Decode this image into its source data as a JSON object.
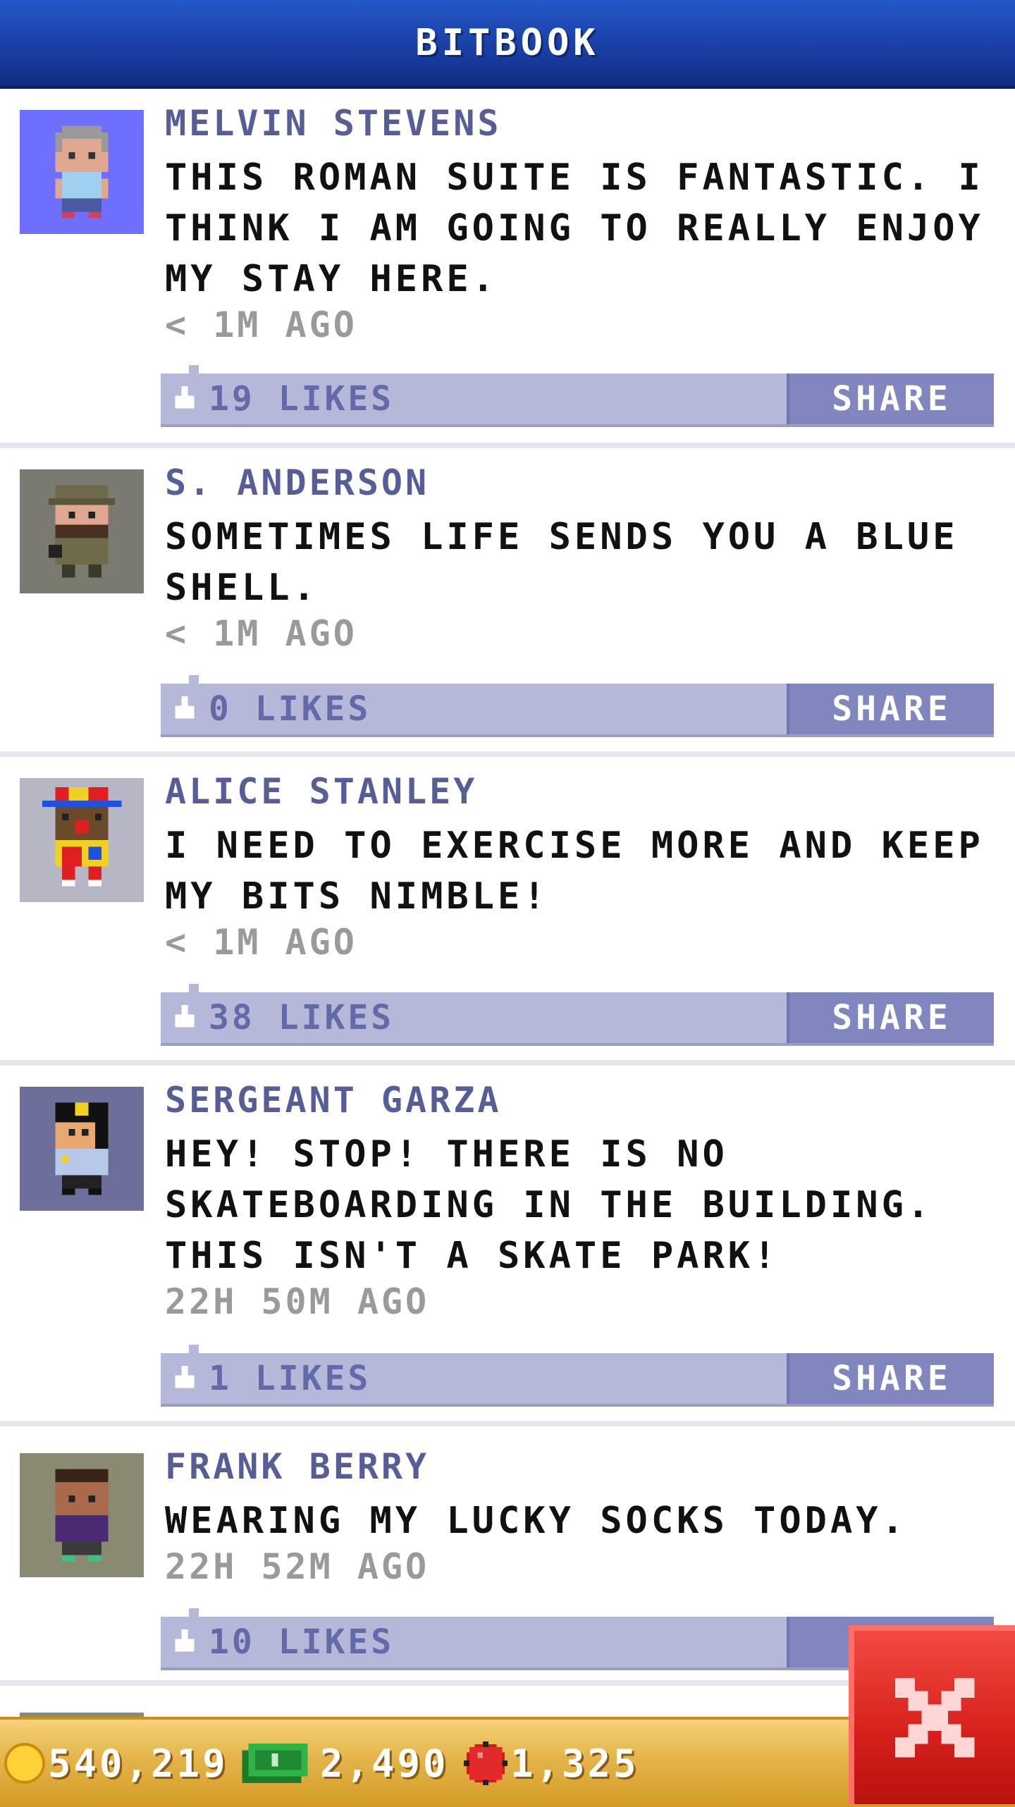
{
  "header": {
    "title": "BITBOOK"
  },
  "posts": [
    {
      "author": "MELVIN STEVENS",
      "message": "THIS ROMAN SUITE IS FANTASTIC. I THINK I AM GOING TO REALLY ENJOY MY STAY HERE.",
      "time": "< 1M AGO",
      "likes": "19 LIKES",
      "share": "SHARE",
      "avatar_bg": "#6f6fff",
      "avatar_icon": "elder-avatar-icon"
    },
    {
      "author": "S. ANDERSON",
      "message": "SOMETIMES LIFE SENDS YOU A BLUE SHELL.",
      "time": "< 1M AGO",
      "likes": "0 LIKES",
      "share": "SHARE",
      "avatar_bg": "#7a7a70",
      "avatar_icon": "soldier-avatar-icon"
    },
    {
      "author": "ALICE STANLEY",
      "message": "I NEED TO EXERCISE MORE AND KEEP MY BITS NIMBLE!",
      "time": "< 1M AGO",
      "likes": "38 LIKES",
      "share": "SHARE",
      "avatar_bg": "#b6b6c4",
      "avatar_icon": "clown-avatar-icon"
    },
    {
      "author": "SERGEANT GARZA",
      "message": "HEY! STOP! THERE IS NO SKATEBOARDING IN THE BUILDING. THIS ISN'T A SKATE PARK!",
      "time": "22H 50M AGO",
      "likes": "1 LIKES",
      "share": "SHARE",
      "avatar_bg": "#6b6f9a",
      "avatar_icon": "police-avatar-icon"
    },
    {
      "author": "FRANK BERRY",
      "message": "WEARING MY LUCKY SOCKS TODAY.",
      "time": "22H 52M AGO",
      "likes": "10 LIKES",
      "share": "SH",
      "avatar_bg": "#8a8a72",
      "avatar_icon": "man-avatar-icon"
    }
  ],
  "resources": {
    "coins": "540,219",
    "bux": "2,490",
    "gems": "1,325"
  },
  "colors": {
    "header": "#17399c",
    "accent": "#575e97",
    "like_bar": "#b6b8da",
    "share": "#8186be",
    "bottom_bar": "#e3b44a",
    "close": "#d61f1b"
  },
  "icons": {
    "coin": "coin-icon",
    "bux": "bux-icon",
    "gem": "gem-icon",
    "close": "close-icon",
    "like": "thumb-up-icon"
  }
}
